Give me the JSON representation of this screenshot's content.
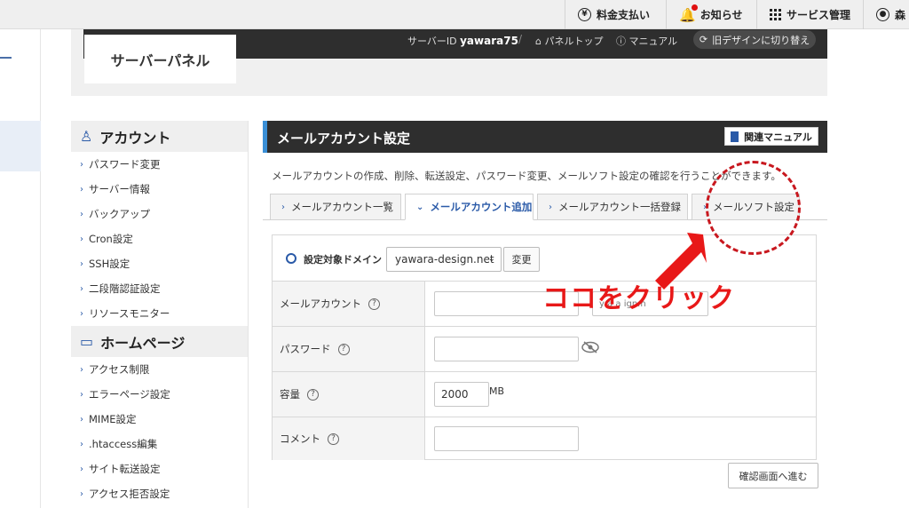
{
  "topbar": {
    "payment": "料金支払い",
    "notice": "お知らせ",
    "service": "サービス管理",
    "user": "森"
  },
  "header": {
    "logo": "サーバーパネル",
    "server_id_label": "サーバーID",
    "server_id": "yawara75",
    "panel_top": "パネルトップ",
    "manual": "マニュアル",
    "old_design": "旧デザインに切り替え"
  },
  "sidebar": {
    "section1": "アカウント",
    "items1": [
      "パスワード変更",
      "サーバー情報",
      "バックアップ",
      "Cron設定",
      "SSH設定",
      "二段階認証設定",
      "リソースモニター"
    ],
    "section2": "ホームページ",
    "items2": [
      "アクセス制限",
      "エラーページ設定",
      "MIME設定",
      ".htaccess編集",
      "サイト転送設定",
      "アクセス拒否設定"
    ]
  },
  "main": {
    "title": "メールアカウント設定",
    "manual_btn": "関連マニュアル",
    "description": "メールアカウントの作成、削除、転送設定、パスワード変更、メールソフト設定の確認を行うことができます。",
    "tabs": [
      "メールアカウント一覧",
      "メールアカウント追加",
      "メールアカウント一括登録",
      "メールソフト設定"
    ],
    "active_tab": "メールアカウント追加"
  },
  "form": {
    "domain_label": "設定対象ドメイン",
    "domain_value": "yawara-design.net",
    "change_btn": "変更",
    "account_label": "メールアカウント",
    "account_domain_partial": "y a a ign.n",
    "password_label": "パスワード",
    "capacity_label": "容量",
    "capacity_value": "2000",
    "capacity_unit": "MB",
    "comment_label": "コメント",
    "confirm_btn": "確認画面へ進む"
  },
  "annotation": {
    "text": "ココをクリック",
    "color": "#e81818"
  }
}
